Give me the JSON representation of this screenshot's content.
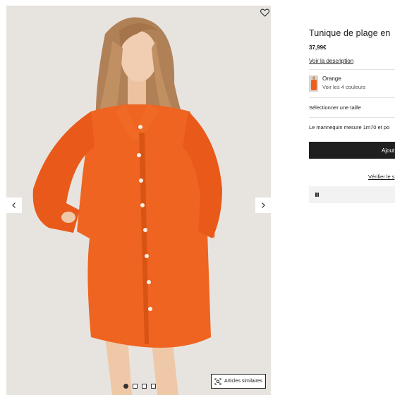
{
  "product": {
    "title": "Tunique de plage en",
    "price": "37,99€",
    "description_link": "Voir la description"
  },
  "color": {
    "name": "Orange",
    "see_all": "Voir les 4 couleurs",
    "accent": "#ee5f1e"
  },
  "size": {
    "select_label": "Sélectionner une taille"
  },
  "model_info": "Le mannequin mesure 1m70 et po",
  "actions": {
    "add_label": "Ajout",
    "verify_link": "Vérifier le s"
  },
  "gallery": {
    "similar_label": "Articles similaires",
    "slide_count": 4,
    "active_slide": 1
  }
}
